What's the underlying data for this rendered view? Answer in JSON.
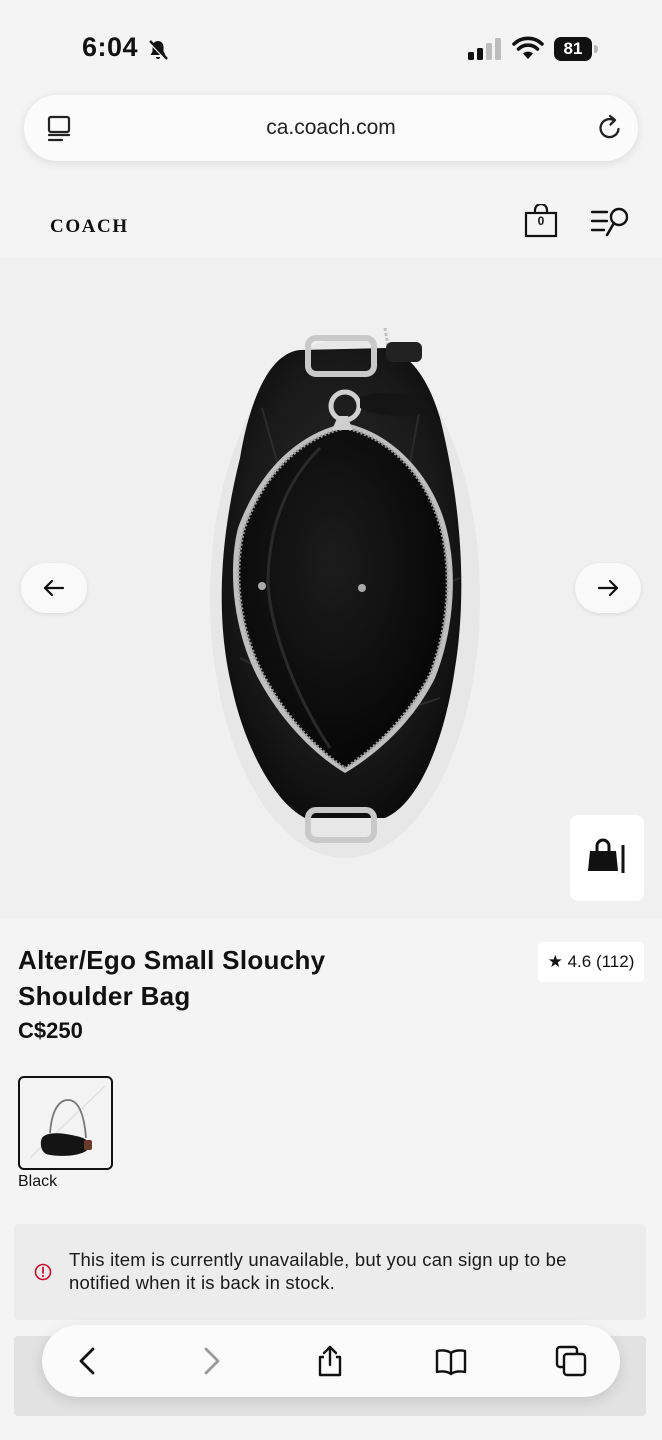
{
  "status_bar": {
    "time": "6:04",
    "battery": "81"
  },
  "browser": {
    "url": "ca.coach.com"
  },
  "site": {
    "logo": "COACH",
    "cart_count": "0"
  },
  "product": {
    "title_line1": "Alter/Ego Small Slouchy",
    "title_line2": "Shoulder Bag",
    "price": "C$250",
    "rating": "★ 4.6 (112)",
    "color_label": "Black"
  },
  "notice": {
    "text": "This item is currently unavailable, but you can sign up to be notified when it is back in stock."
  },
  "icons": {
    "status": [
      "bell-slash-icon",
      "cellular-signal-icon",
      "wifi-icon",
      "battery-icon"
    ],
    "browser": [
      "reader-view-icon",
      "reload-icon"
    ],
    "header": [
      "shopping-bag-icon",
      "menu-search-icon"
    ],
    "gallery": [
      "arrow-left-icon",
      "arrow-right-icon",
      "view-in-ar-bag-icon"
    ],
    "toolbar": [
      "back-icon",
      "forward-icon",
      "share-icon",
      "bookmarks-icon",
      "tabs-icon"
    ]
  }
}
